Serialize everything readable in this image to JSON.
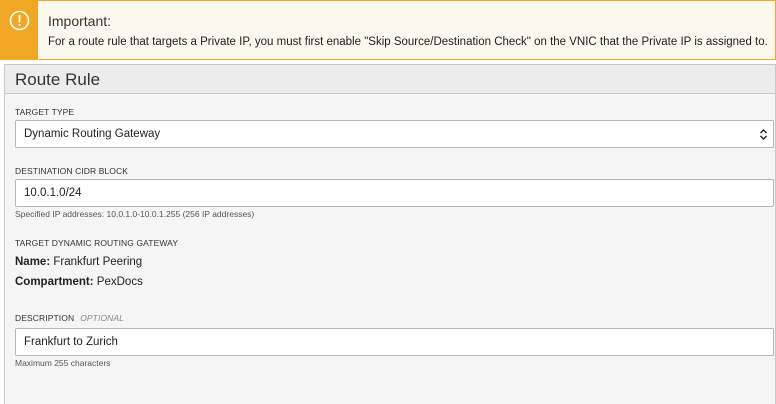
{
  "alert": {
    "icon": "warning-icon",
    "title": "Important:",
    "message": "For a route rule that targets a Private IP, you must first enable \"Skip Source/Destination Check\" on the VNIC that the Private IP is assigned to."
  },
  "panel": {
    "title": "Route Rule",
    "target_type": {
      "label": "TARGET TYPE",
      "value": "Dynamic Routing Gateway"
    },
    "destination": {
      "label": "DESTINATION CIDR BLOCK",
      "value": "10.0.1.0/24",
      "hint": "Specified IP addresses: 10.0.1.0-10.0.1.255 (256 IP addresses)"
    },
    "target_drg": {
      "label": "TARGET DYNAMIC ROUTING GATEWAY",
      "name_label": "Name:",
      "name_value": "Frankfurt Peering",
      "compartment_label": "Compartment:",
      "compartment_value": "PexDocs"
    },
    "description": {
      "label": "DESCRIPTION",
      "optional": "OPTIONAL",
      "value": "Frankfurt to Zurich",
      "hint": "Maximum 255 characters"
    }
  },
  "colors": {
    "alert_accent": "#f2a724",
    "alert_bg": "#fcf8ed",
    "panel_bg": "#f5f5f5"
  }
}
